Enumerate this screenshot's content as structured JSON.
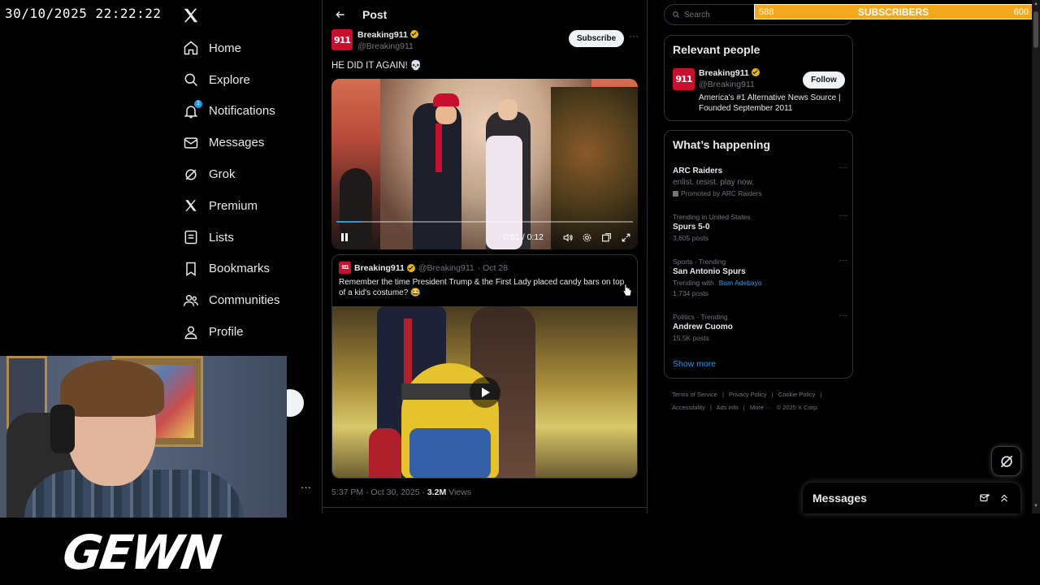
{
  "overlay": {
    "datetime": "30/10/2025 22:22:22",
    "brand": "GEWN",
    "subscribers": {
      "current": "588",
      "label": "SUBSCRIBERS",
      "goal": "600",
      "progress": 0.98,
      "bar_color": "#f4a81d"
    }
  },
  "nav": {
    "items": [
      {
        "label": "Home",
        "icon": "home-icon"
      },
      {
        "label": "Explore",
        "icon": "search-icon"
      },
      {
        "label": "Notifications",
        "icon": "bell-icon",
        "badge": "1"
      },
      {
        "label": "Messages",
        "icon": "envelope-icon"
      },
      {
        "label": "Grok",
        "icon": "grok-icon"
      },
      {
        "label": "Premium",
        "icon": "x-logo-icon"
      },
      {
        "label": "Lists",
        "icon": "list-icon"
      },
      {
        "label": "Bookmarks",
        "icon": "bookmark-icon"
      },
      {
        "label": "Communities",
        "icon": "people-icon"
      },
      {
        "label": "Profile",
        "icon": "person-icon"
      }
    ],
    "more_label": "···"
  },
  "post": {
    "header_title": "Post",
    "author": {
      "name": "Breaking911",
      "handle": "@Breaking911",
      "avatar_text": "911"
    },
    "subscribe_label": "Subscribe",
    "more_label": "···",
    "text": "HE DID IT AGAIN! 💀",
    "video": {
      "time": "0:01 / 0:12",
      "progress": 0.08
    },
    "quote": {
      "name": "Breaking911",
      "handle": "@Breaking911",
      "date": "· Oct 28",
      "text": "Remember the time President Trump & the First Lady placed candy bars on top of a kid's costume? 😂"
    },
    "meta_time": "5:37 PM · Oct 30, 2025 · ",
    "meta_views_count": "3.2M",
    "meta_views_label": " Views"
  },
  "right": {
    "search_placeholder": "Search",
    "relevant": {
      "title": "Relevant people",
      "name": "Breaking911",
      "handle": "@Breaking911",
      "bio": "America's #1 Alternative News Source | Founded September 2011",
      "follow_label": "Follow"
    },
    "happening": {
      "title": "What’s happening",
      "trends": [
        {
          "context": "",
          "name": "ARC Raiders",
          "sub": "enlist. resist. play now.",
          "promo": "Promoted by ARC Raiders"
        },
        {
          "context": "Trending in United States",
          "name": "Spurs 5-0",
          "sub": "3,605 posts"
        },
        {
          "context": "Sports · Trending",
          "name": "San Antonio Spurs",
          "sub": "Trending with",
          "link": "Bam Adebayo",
          "sub2": "1,734 posts"
        },
        {
          "context": "Politics · Trending",
          "name": "Andrew Cuomo",
          "sub": "15.5K posts"
        }
      ],
      "show_more": "Show more"
    },
    "footer": [
      "Terms of Service",
      "|",
      "Privacy Policy",
      "|",
      "Cookie Policy",
      "|",
      "Accessibility",
      "|",
      "Ads info",
      "|",
      "More ···",
      "© 2025 X Corp."
    ]
  },
  "messages_drawer": {
    "title": "Messages"
  },
  "colors": {
    "accent": "#1d9bf0",
    "verified": "#e2b719",
    "brand_red": "#c8102e"
  }
}
